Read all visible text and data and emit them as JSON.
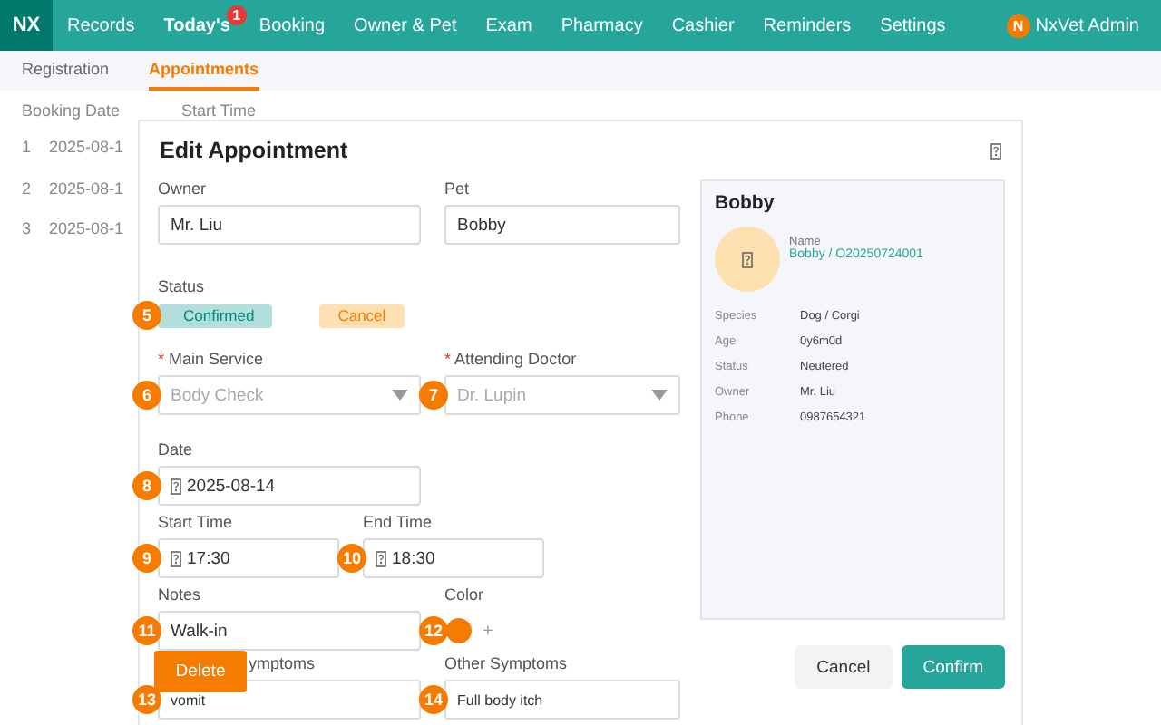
{
  "nav": {
    "logo": "NX",
    "items": [
      {
        "label": "Records",
        "selected": false
      },
      {
        "label": "Today's",
        "selected": true,
        "badge": "1"
      },
      {
        "label": "Booking",
        "selected": false
      },
      {
        "label": "Owner & Pet",
        "selected": false
      },
      {
        "label": "Exam",
        "selected": false
      },
      {
        "label": "Pharmacy",
        "selected": false
      },
      {
        "label": "Cashier",
        "selected": false
      },
      {
        "label": "Reminders",
        "selected": false
      },
      {
        "label": "Settings",
        "selected": false
      }
    ],
    "user": {
      "initial": "N",
      "name": "NxVet Admin"
    }
  },
  "subnav": [
    {
      "label": "Registration",
      "selected": false
    },
    {
      "label": "Appointments",
      "selected": true
    }
  ],
  "table": {
    "columns": [
      "Booking Date",
      "Start Time"
    ],
    "rows": [
      {
        "index": "1",
        "date": "2025-08-1"
      },
      {
        "index": "2",
        "date": "2025-08-1"
      },
      {
        "index": "3",
        "date": "2025-08-1"
      }
    ]
  },
  "dialog": {
    "title": "Edit Appointment",
    "owner": {
      "label": "Owner",
      "value": "Mr. Liu"
    },
    "pet": {
      "label": "Pet",
      "value": "Bobby"
    },
    "status": {
      "label": "Status",
      "marker": "5",
      "options": [
        {
          "label": "Confirmed",
          "selected": true
        },
        {
          "label": "Cancel",
          "selected": false
        }
      ]
    },
    "main_service": {
      "label": "Main Service",
      "mark": "*",
      "value": "Body Check",
      "disabled": true,
      "marker": "6"
    },
    "doctor": {
      "label": "Attending Doctor",
      "mark": "*",
      "value": "Dr. Lupin",
      "disabled": true,
      "marker": "7"
    },
    "date": {
      "label": "Date",
      "value": "2025-08-14",
      "marker": "8"
    },
    "start_time": {
      "label": "Start Time",
      "value": "17:30",
      "marker": "9"
    },
    "end_time": {
      "label": "End Time",
      "value": "18:30",
      "marker": "10"
    },
    "notes": {
      "label": "Notes",
      "value": "Walk-in",
      "marker": "11"
    },
    "color": {
      "label": "Color",
      "color": "#f57c00",
      "add": "+",
      "marker": "12"
    },
    "main_symptoms": {
      "label": "ymptoms",
      "value": "vomit",
      "marker": "13"
    },
    "other_symptoms": {
      "label": "Other Symptoms",
      "value": "Full body itch",
      "marker": "14"
    },
    "delete_button": "Delete",
    "pet_card": {
      "title": "Bobby",
      "name_label": "Name",
      "name_link": "Bobby / O20250724001",
      "rows": [
        {
          "label": "Species",
          "value": "Dog / Corgi"
        },
        {
          "label": "Age",
          "value": "0y6m0d"
        },
        {
          "label": "Status",
          "value": "Neutered"
        },
        {
          "label": "Owner",
          "value": "Mr. Liu"
        },
        {
          "label": "Phone",
          "value": "0987654321"
        }
      ]
    },
    "buttons": [
      {
        "label": "Cancel",
        "kind": "secondary"
      },
      {
        "label": "Confirm",
        "kind": "primary"
      }
    ]
  }
}
